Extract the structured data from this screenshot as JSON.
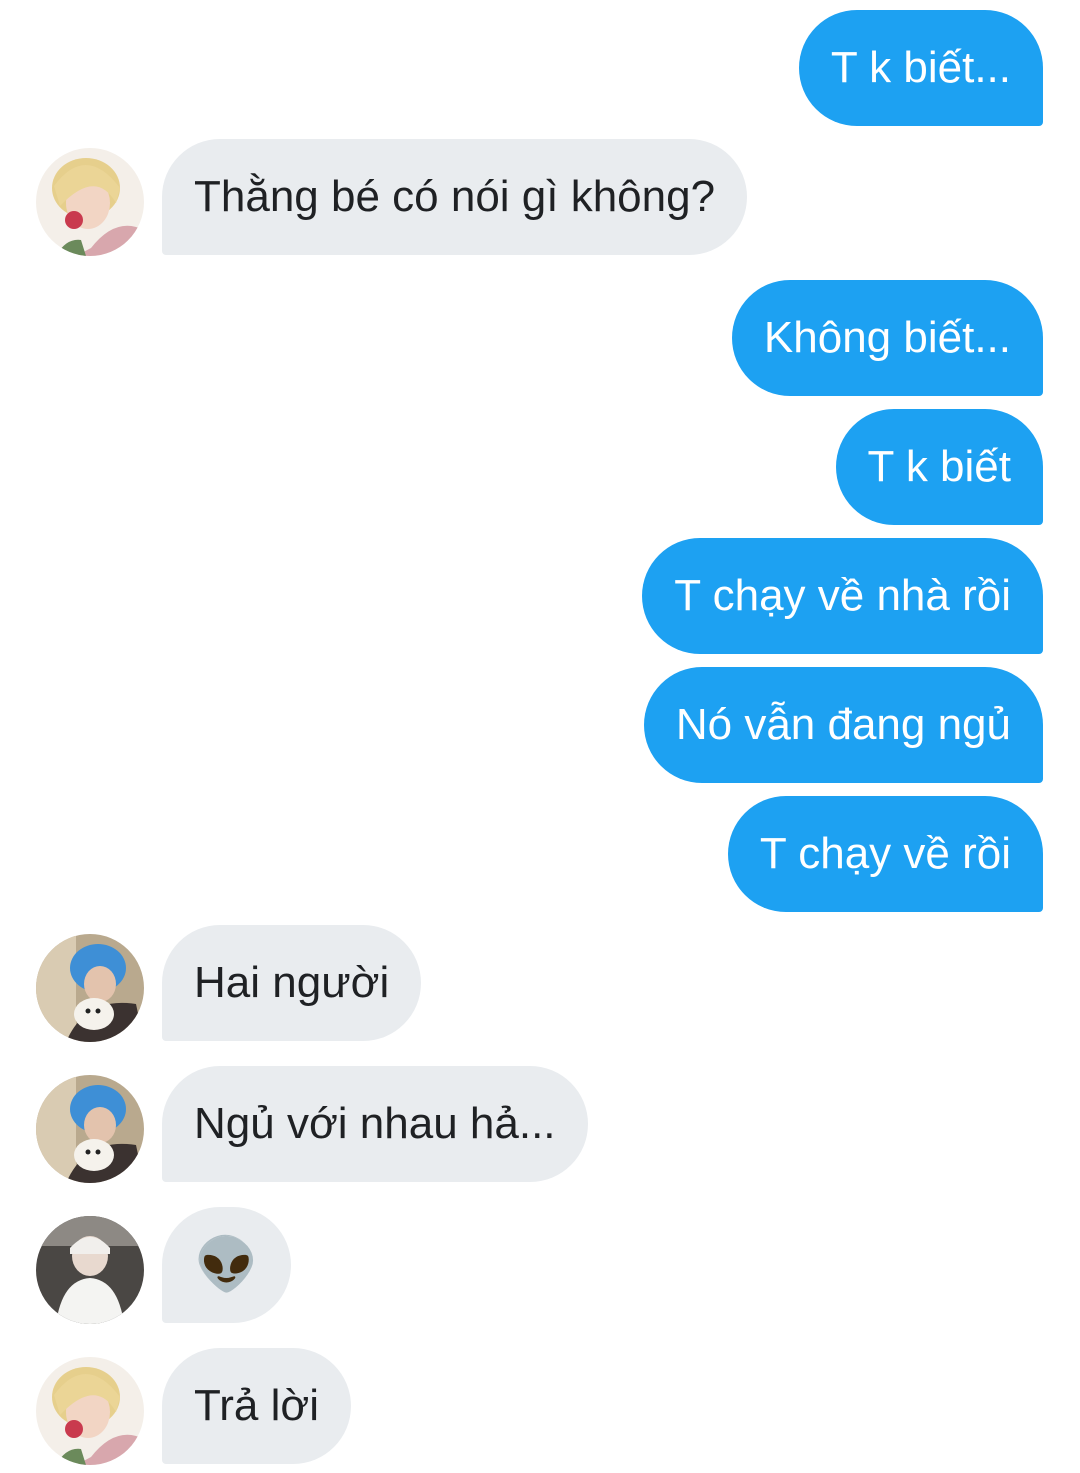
{
  "messages": [
    {
      "side": "sent",
      "text": "T k biết..."
    },
    {
      "side": "received",
      "avatar": "blonde-avatar",
      "text": "Thằng bé có nói gì không?"
    },
    {
      "side": "sent",
      "text": "Không biết..."
    },
    {
      "side": "sent",
      "text": "T k biết"
    },
    {
      "side": "sent",
      "text": "T chạy về nhà rồi"
    },
    {
      "side": "sent",
      "text": "Nó vẫn đang ngủ"
    },
    {
      "side": "sent",
      "text": "T chạy về rồi"
    },
    {
      "side": "received",
      "avatar": "blue-hair-avatar",
      "text": "Hai người"
    },
    {
      "side": "received",
      "avatar": "blue-hair-avatar",
      "text": "Ngủ với nhau hả..."
    },
    {
      "side": "received",
      "avatar": "dark-photo-avatar",
      "text": "👽",
      "emoji_name": "alien-emoji"
    },
    {
      "side": "received",
      "avatar": "blonde-avatar",
      "text": "Trả lời"
    }
  ],
  "colors": {
    "sent_bubble": "#1da1f2",
    "received_bubble": "#e9ecef",
    "sent_text": "#ffffff",
    "received_text": "#1f2124"
  }
}
